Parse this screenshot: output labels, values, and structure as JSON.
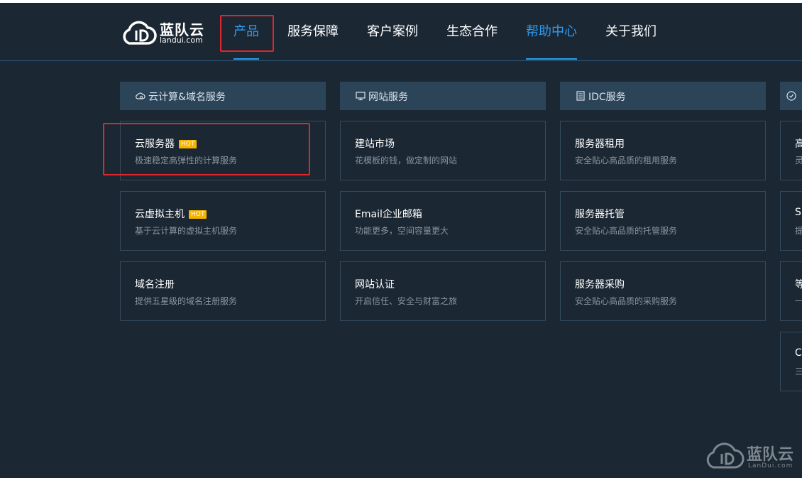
{
  "brand": {
    "name_cn": "蓝队云",
    "domain": "landui.com"
  },
  "nav": [
    {
      "label": "产品",
      "active": true
    },
    {
      "label": "服务保障"
    },
    {
      "label": "客户案例"
    },
    {
      "label": "生态合作"
    },
    {
      "label": "帮助中心",
      "active": true
    },
    {
      "label": "关于我们"
    }
  ],
  "columns": [
    {
      "title": "云计算&域名服务",
      "icon": "cloud-gear-icon",
      "items": [
        {
          "title": "云服务器",
          "badge": "HOT",
          "desc": "极速稳定高弹性的计算服务"
        },
        {
          "title": "云虚拟主机",
          "badge": "HOT",
          "desc": "基于云计算的虚拟主机服务"
        },
        {
          "title": "域名注册",
          "desc": "提供五星级的域名注册服务"
        }
      ]
    },
    {
      "title": "网站服务",
      "icon": "monitor-icon",
      "items": [
        {
          "title": "建站市场",
          "desc": "花模板的钱，做定制的网站"
        },
        {
          "title": "Email企业邮箱",
          "desc": "功能更多，空间容量更大"
        },
        {
          "title": "网站认证",
          "desc": "开启信任、安全与财富之旅"
        }
      ]
    },
    {
      "title": "IDC服务",
      "icon": "server-doc-icon",
      "items": [
        {
          "title": "服务器租用",
          "desc": "安全贴心高品质的租用服务"
        },
        {
          "title": "服务器托管",
          "desc": "安全贴心高品质的托管服务"
        },
        {
          "title": "服务器采购",
          "desc": "安全贴心高品质的采购服务"
        }
      ]
    }
  ],
  "partial_column": {
    "icon": "shield-icon",
    "items": [
      {
        "title": "高",
        "desc": "灵"
      },
      {
        "title": "S",
        "desc": "提"
      },
      {
        "title": "等",
        "desc": "一"
      },
      {
        "title": "C",
        "desc": "三"
      }
    ]
  },
  "watermark": {
    "cn": "蓝队云",
    "en": "LanDui.com"
  },
  "colors": {
    "background": "#1b2733",
    "accent": "#2e9cf0",
    "header_bg": "#2c4458",
    "hot": "#f5b400",
    "highlight": "#e0262a"
  }
}
